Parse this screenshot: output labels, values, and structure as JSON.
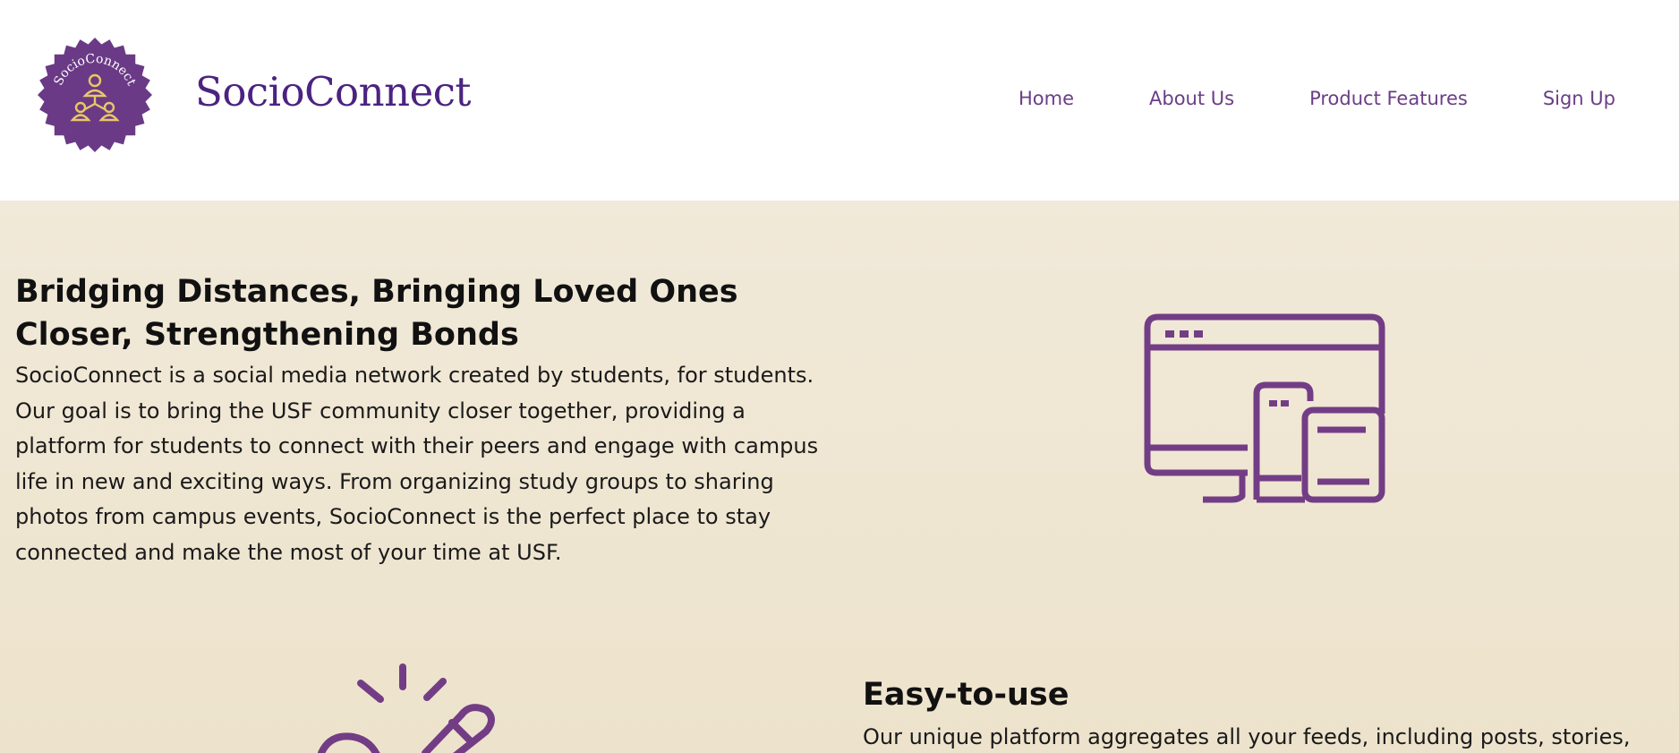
{
  "header": {
    "logo_text": "SocioConnect",
    "brand_name": "SocioConnect",
    "nav": [
      {
        "label": "Home"
      },
      {
        "label": "About Us"
      },
      {
        "label": "Product Features"
      },
      {
        "label": "Sign Up"
      }
    ]
  },
  "hero": {
    "title": "Bridging Distances, Bringing Loved Ones Closer, Strengthening Bonds",
    "body": "SocioConnect is a social media network created by students, for students. Our goal is to bring the USF community closer together, providing a platform for students to connect with their peers and engage with campus life in new and exciting ways. From organizing study groups to sharing photos from campus events, SocioConnect is the perfect place to stay connected and make the most of your time at USF.",
    "icon": "devices-icon"
  },
  "feature": {
    "title": "Easy-to-use",
    "body": "Our unique platform aggregates all your feeds, including posts, stories,",
    "icon": "tap-icon"
  },
  "colors": {
    "brand_purple": "#4b2380",
    "nav_purple": "#6b3d86",
    "icon_purple": "#733d86",
    "badge_purple": "#6a3a86",
    "badge_gold": "#e9c766",
    "section_bg": "#f1e9d9"
  }
}
